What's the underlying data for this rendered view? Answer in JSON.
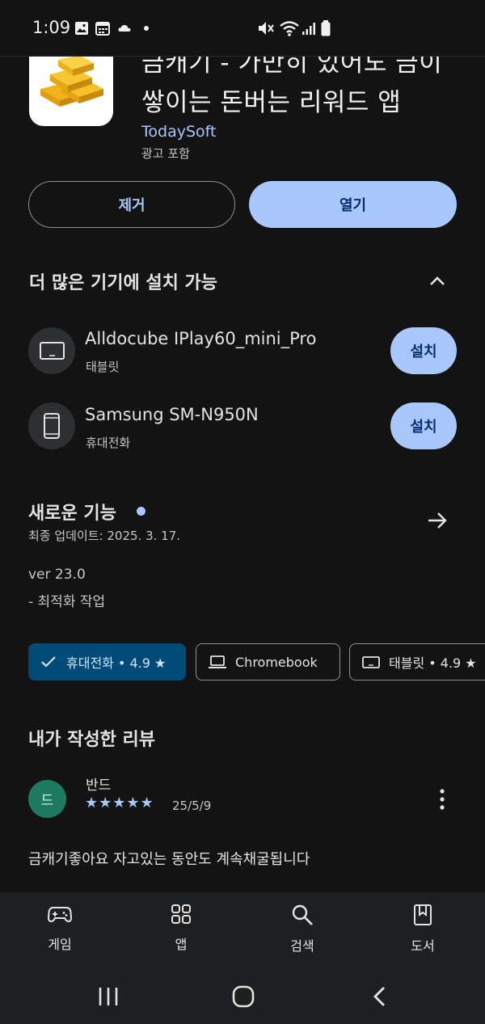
{
  "status_bar": {
    "time": "1:09",
    "icons": [
      "gallery-icon",
      "calendar-icon",
      "cloud-icon",
      "dot-icon",
      "mute-icon",
      "wifi-icon",
      "signal-icon",
      "battery-icon"
    ]
  },
  "app": {
    "title_line1": "금캐기 - 가만히 있어도 금이",
    "title_line2": "쌓이는 돈버는 리워드 앱",
    "developer": "TodaySoft",
    "ads_note": "광고 포함",
    "uninstall_label": "제거",
    "open_label": "열기"
  },
  "more_devices": {
    "title": "더 많은 기기에 설치 가능",
    "devices": [
      {
        "name": "Alldocube IPlay60_mini_Pro",
        "type": "태블릿",
        "icon": "tablet-icon",
        "action": "설치"
      },
      {
        "name": "Samsung SM-N950N",
        "type": "휴대전화",
        "icon": "phone-icon",
        "action": "설치"
      }
    ]
  },
  "whats_new": {
    "title": "새로운 기능",
    "updated": "최종 업데이트: 2025. 3. 17.",
    "version": "ver 23.0",
    "changes": "- 최적화 작업"
  },
  "device_chips": [
    {
      "label": "휴대전화 • 4.9 ★",
      "icon": "check-icon",
      "selected": true
    },
    {
      "label": "Chromebook",
      "icon": "laptop-icon",
      "selected": false
    },
    {
      "label": "태블릿 • 4.9 ★",
      "icon": "tablet-icon",
      "selected": false
    }
  ],
  "my_review": {
    "title": "내가 작성한 리뷰",
    "avatar_letter": "드",
    "reviewer": "반드",
    "stars": "★★★★★",
    "rating": 5,
    "date": "25/5/9",
    "text": "금캐기좋아요 자고있는 동안도 계속채굴됩니다",
    "peek": "…"
  },
  "bottom_nav": [
    {
      "label": "게임",
      "icon": "gamepad-icon"
    },
    {
      "label": "앱",
      "icon": "apps-grid-icon"
    },
    {
      "label": "검색",
      "icon": "search-icon"
    },
    {
      "label": "도서",
      "icon": "book-icon"
    }
  ],
  "system_nav": [
    "recents-icon",
    "home-icon",
    "back-icon"
  ],
  "colors": {
    "background": "#131314",
    "accent": "#a8c7fa",
    "accent_text": "#062e6f",
    "selected_chip": "#004a77",
    "avatar": "#1c7a63"
  }
}
